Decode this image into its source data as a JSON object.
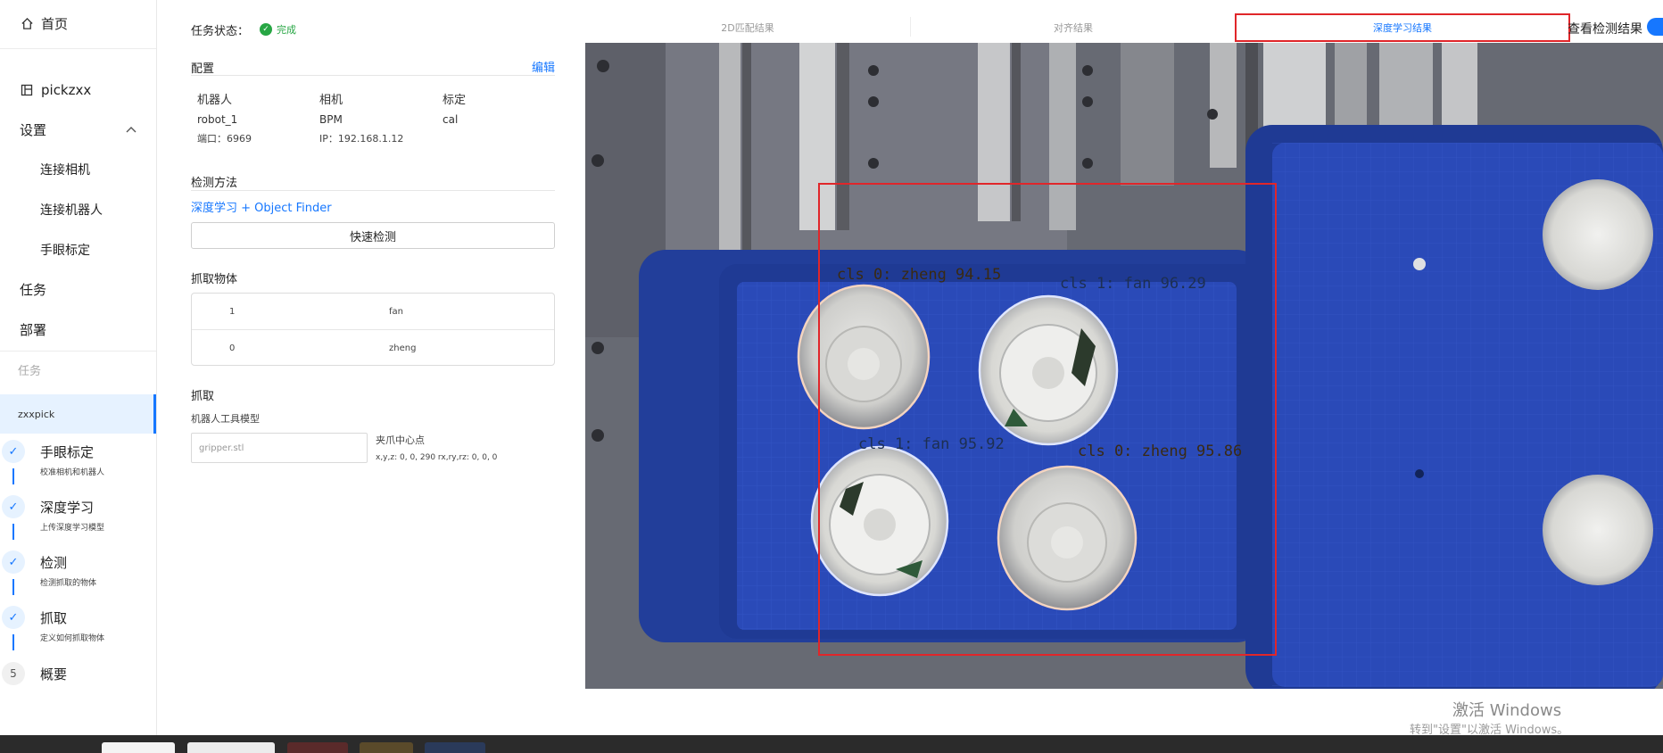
{
  "sidebar": {
    "home": "首页",
    "project": "pickzxx",
    "settings": "设置",
    "settings_items": [
      "连接相机",
      "连接机器人",
      "手眼标定"
    ],
    "tasks": "任务",
    "deploy": "部署",
    "task_section": "任务",
    "active_task": "zxxpick",
    "steps": [
      {
        "title": "手眼标定",
        "desc": "校准相机和机器人",
        "mark": "✓"
      },
      {
        "title": "深度学习",
        "desc": "上传深度学习模型",
        "mark": "✓"
      },
      {
        "title": "检测",
        "desc": "检测抓取的物体",
        "mark": "✓"
      },
      {
        "title": "抓取",
        "desc": "定义如何抓取物体",
        "mark": "✓"
      },
      {
        "title": "概要",
        "desc": "",
        "mark": "5"
      }
    ]
  },
  "panel": {
    "task_status_label": "任务状态：",
    "task_status_value": "完成",
    "config_title": "配置",
    "edit": "编辑",
    "robot_header": "机器人",
    "camera_header": "相机",
    "calib_header": "标定",
    "robot_name": "robot_1",
    "robot_port": "端口：6969",
    "camera_name": "BPM",
    "camera_ip": "IP：192.168.1.12",
    "calib_name": "cal",
    "detect_title": "检测方法",
    "detect_method": "深度学习 + Object Finder",
    "quick_detect": "快速检测",
    "grab_objects_title": "抓取物体",
    "objects": [
      {
        "id": "1",
        "name": "fan"
      },
      {
        "id": "0",
        "name": "zheng"
      }
    ],
    "grab_title": "抓取",
    "tool_model_label": "机器人工具模型",
    "tool_model_placeholder": "gripper.stl",
    "gripper_center_label": "夹爪中心点",
    "gripper_center_value": "x,y,z: 0, 0, 290 rx,ry,rz: 0, 0, 0"
  },
  "tabs": {
    "items": [
      "2D匹配结果",
      "对齐结果",
      "深度学习结果"
    ],
    "active": "深度学习结果",
    "view_label": "查看检测结果"
  },
  "detections": [
    {
      "label": "cls 0: zheng 94.15",
      "color": "#3a2a12"
    },
    {
      "label": "cls 1: fan 96.29",
      "color": "#1d2f52"
    },
    {
      "label": "cls 1: fan 95.92",
      "color": "#1d2f52"
    },
    {
      "label": "cls 0: zheng 95.86",
      "color": "#3a2a12"
    }
  ],
  "watermark": {
    "line1": "激活 Windows",
    "line2": "转到\"设置\"以激活 Windows。"
  },
  "colors": {
    "accent": "#1677ff",
    "success": "#27a644",
    "box": "#e0262a",
    "tray": "#2446a8"
  }
}
